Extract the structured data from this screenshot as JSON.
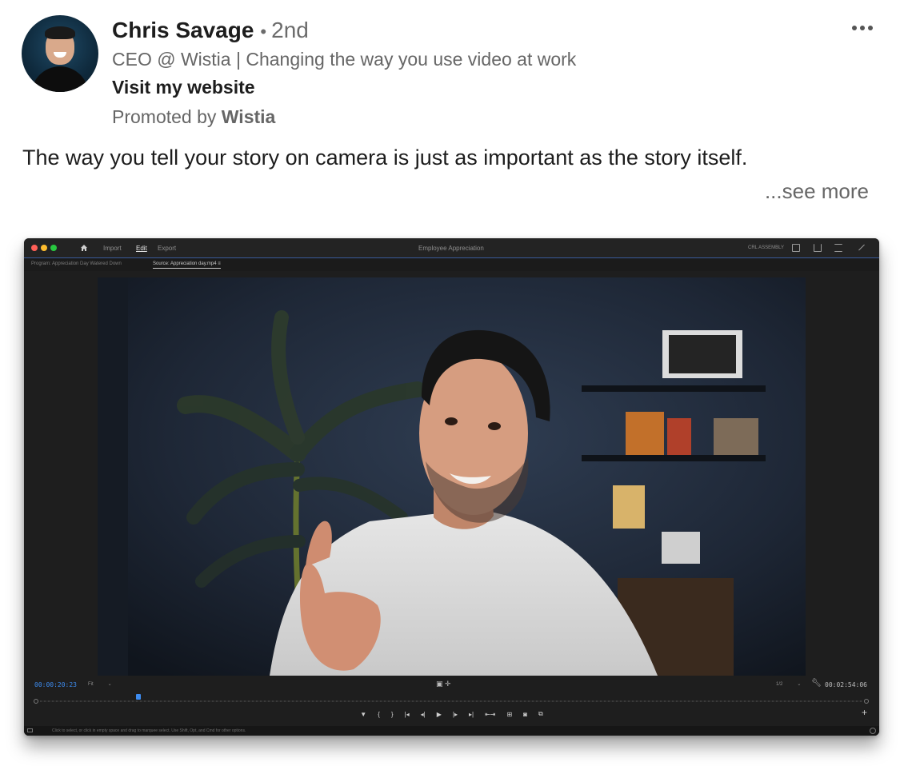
{
  "post": {
    "author_name": "Chris Savage",
    "degree_separator": "•",
    "degree": "2nd",
    "headline": "CEO @ Wistia | Changing the way you use video at work",
    "website_link": "Visit my website",
    "promoted_prefix": "Promoted by ",
    "promoted_company": "Wistia",
    "text": "The way you tell your story on camera is just as important as the story itself.",
    "see_more": "...see more",
    "more_icon": "ellipsis-icon",
    "avatar_icon": "avatar-photo"
  },
  "editor": {
    "nav": {
      "home_icon": "home-icon",
      "import": "Import",
      "edit": "Edit",
      "export": "Export"
    },
    "project_title": "Employee Appreciation",
    "workspace": "CRL ASSEMBLY",
    "tabs": {
      "program": "Program: Appreciation Day Watered Down",
      "source": "Source: Appreciation day.mp4"
    },
    "source_menu_glyph": "≡",
    "controls": {
      "timecode_current": "00:00:20:23",
      "fit": "Fit",
      "resolution": "1/2",
      "timecode_duration": "00:02:54:06",
      "caret": "⌄",
      "center_glyph": "▣ ✛",
      "playhead_progress": 0.12,
      "transport": [
        "▼",
        "{",
        "}",
        "|◂",
        "◂|",
        "▶",
        "|▸",
        "▸|",
        "⇤⇥",
        "⊞",
        "◙",
        "⧉"
      ],
      "add": "+"
    },
    "status_text": "Click to select, or click in empty space and drag to marquee select. Use Shift, Opt, and Cmd for other options.",
    "colors": {
      "accent_blue": "#3d8cf0",
      "close": "#ff5f57",
      "minimize": "#febc2e",
      "zoom": "#28c840"
    }
  }
}
